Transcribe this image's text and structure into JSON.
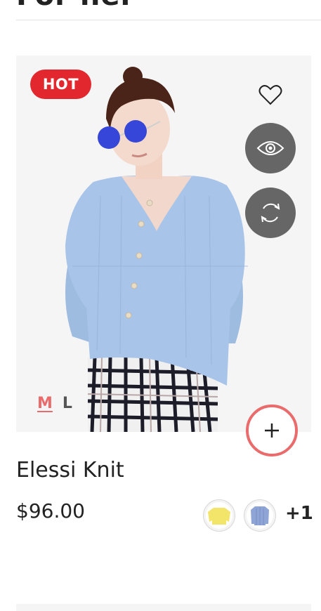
{
  "section": {
    "title": "For her"
  },
  "product": {
    "badge": "HOT",
    "name": "Elessi Knit",
    "price": "$96.00",
    "sizes": [
      "M",
      "L"
    ],
    "selected_size": "M",
    "more_colors": "+1",
    "swatches": [
      "yellow-sweater",
      "blue-sweater"
    ],
    "icons": {
      "wishlist": "heart-icon",
      "quickview": "eye-icon",
      "compare": "refresh-icon",
      "add": "plus-icon"
    },
    "colors": {
      "badge": "#e2272e",
      "accent": "#ea6b6b",
      "action_bg": "#666666"
    }
  }
}
